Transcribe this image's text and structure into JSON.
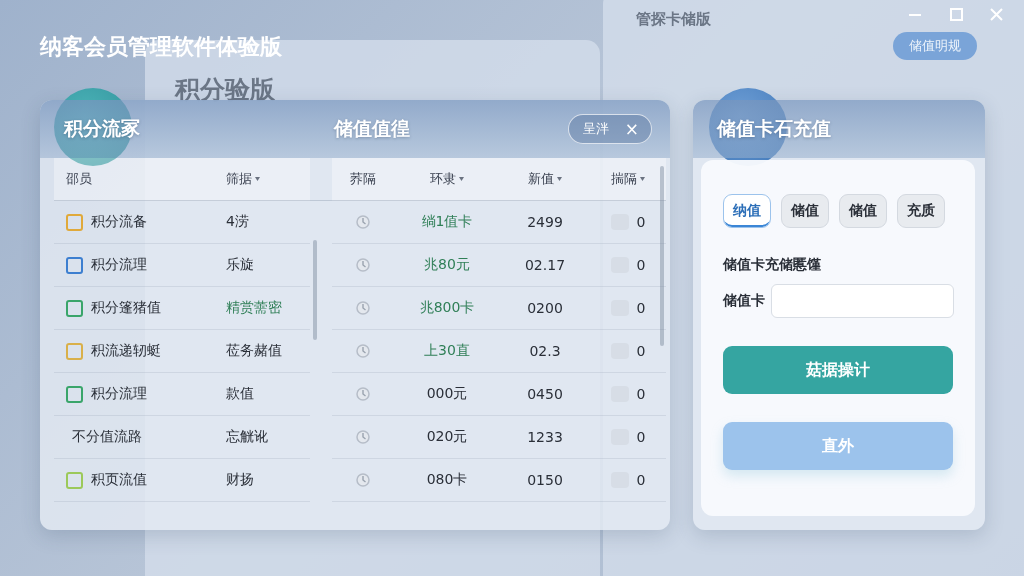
{
  "backdrop": {
    "left_window_title": "积分验版",
    "right_window_title": "管探卡储版",
    "right_window_button": "储值明规"
  },
  "app_title": "纳客会员管理软件体验版",
  "points_panel": {
    "badge_title": "积分流冢",
    "title": "储值值徨",
    "filter_button": {
      "label": "呈泮",
      "close": "×"
    },
    "columns": [
      {
        "label": "邵员",
        "sortable": false
      },
      {
        "label": "筛据",
        "sortable": true
      },
      {
        "label": "荞隔",
        "sortable": false
      },
      {
        "label": "环隶",
        "sortable": true
      },
      {
        "label": "新值",
        "sortable": true
      },
      {
        "label": "揣隔",
        "sortable": true
      }
    ],
    "rows": [
      {
        "name": "积分流备",
        "color": "#e0a93a",
        "type": "4涝",
        "type_green": false,
        "amount": "绱1值卡",
        "amount_green": true,
        "value": "2499",
        "checked": false,
        "count": "0"
      },
      {
        "name": "积分流理",
        "color": "#3d7fd0",
        "type": "乐旋",
        "type_green": false,
        "amount": "兆80元",
        "amount_green": true,
        "value": "02.17",
        "checked": false,
        "count": "0"
      },
      {
        "name": "积分篷猪值",
        "color": "#3aa56a",
        "type": "精赏薷密",
        "type_green": true,
        "amount": "兆800卡",
        "amount_green": true,
        "value": "0200",
        "checked": false,
        "count": "0"
      },
      {
        "name": "积流递轫蜓",
        "color": "#d9b04a",
        "type": "莅务赭值",
        "type_green": false,
        "amount": "上30直",
        "amount_green": true,
        "value": "02.3",
        "checked": false,
        "count": "0"
      },
      {
        "name": "积分流理",
        "color": "#3aa56a",
        "type": "款值",
        "type_green": false,
        "amount": "000元",
        "amount_green": false,
        "value": "0450",
        "checked": false,
        "count": "0"
      },
      {
        "name": "不分值流路",
        "type": "忘觥讹",
        "type_green": false,
        "amount": "020元",
        "amount_green": false,
        "value": "1233",
        "checked": false,
        "count": "0"
      },
      {
        "name": "积页流值",
        "color": "#9cc95a",
        "type": "财扬",
        "type_green": false,
        "amount": "080卡",
        "amount_green": false,
        "value": "0150",
        "checked": false,
        "count": "0"
      }
    ]
  },
  "recharge_panel": {
    "badge_title": "储值卡石充值",
    "tabs": [
      {
        "label": "纳值",
        "selected": true
      },
      {
        "label": "储值",
        "selected": false
      },
      {
        "label": "储值",
        "selected": false
      },
      {
        "label": "充质",
        "selected": false
      }
    ],
    "section_label": "储值卡充储慝馑",
    "field_label": "储值卡",
    "buttons": [
      {
        "label": "菇据操计",
        "kind": "primary"
      },
      {
        "label": "直外",
        "kind": "secondary"
      }
    ]
  }
}
